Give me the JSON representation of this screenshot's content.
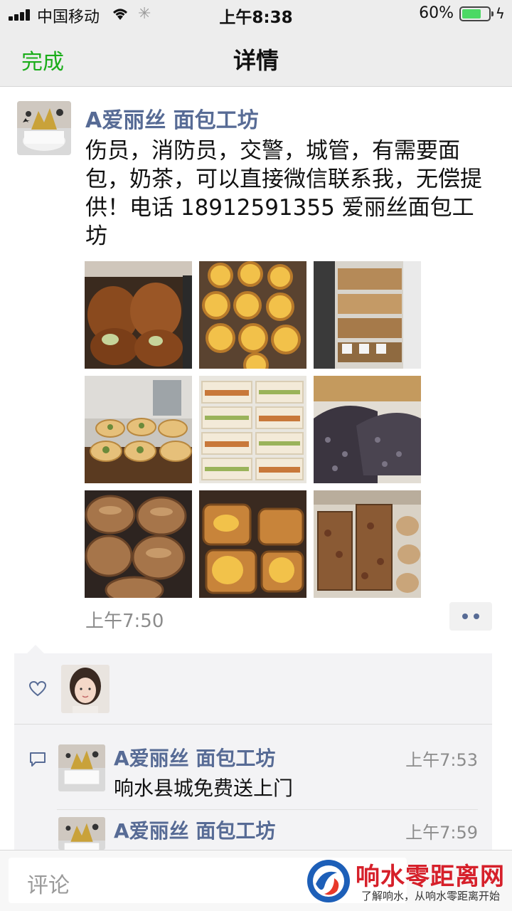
{
  "status_bar": {
    "carrier": "中国移动",
    "time": "上午8:38",
    "battery": "60%",
    "battery_level": 0.6
  },
  "nav": {
    "done_label": "完成",
    "title": "详情"
  },
  "post": {
    "author": "A爱丽丝 面包工坊",
    "text": "伤员，消防员，交警，城管，有需要面包，奶茶，可以直接微信联系我，无偿提供！电话 18912591355 爱丽丝面包工坊",
    "time": "上午7:50",
    "photo_count": 9
  },
  "comments": [
    {
      "author": "A爱丽丝 面包工坊",
      "time": "上午7:53",
      "text": "响水县城免费送上门"
    },
    {
      "author": "A爱丽丝 面包工坊",
      "time": "上午7:59",
      "text": ""
    }
  ],
  "comment_bar": {
    "placeholder": "评论"
  },
  "watermark": {
    "title": "响水零距离网",
    "subtitle": "了解响水，从响水零距离开始"
  },
  "colors": {
    "accent_green": "#1aad19",
    "name_blue": "#576b95",
    "watermark_red": "#d6202a"
  }
}
